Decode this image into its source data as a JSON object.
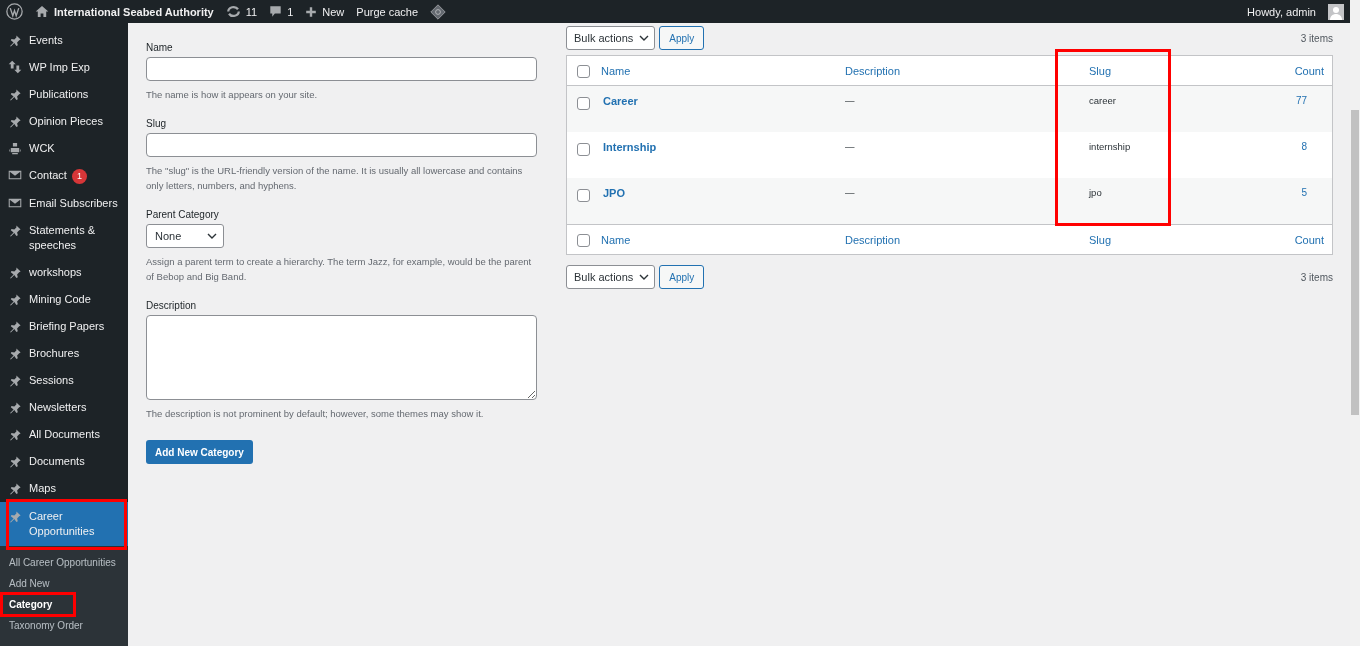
{
  "admin_bar": {
    "site": "International Seabed Authority",
    "updates": "11",
    "comments": "1",
    "new_label": "New",
    "purge": "Purge cache",
    "greeting": "Howdy, admin"
  },
  "sidebar": {
    "items": [
      {
        "label": "Events",
        "kind": "pin",
        "selected": false,
        "highlighted": false
      },
      {
        "label": "WP Imp Exp",
        "kind": "arrows",
        "selected": false,
        "highlighted": false
      },
      {
        "label": "Publications",
        "kind": "pin",
        "selected": false,
        "highlighted": false
      },
      {
        "label": "Opinion Pieces",
        "kind": "pin",
        "selected": false,
        "highlighted": false
      },
      {
        "label": "WCK",
        "kind": "robot",
        "selected": false,
        "highlighted": false
      },
      {
        "label": "Contact",
        "kind": "mail",
        "badge": "1",
        "selected": false,
        "highlighted": false
      },
      {
        "label": "Email Subscribers",
        "kind": "mail",
        "selected": false,
        "highlighted": false
      },
      {
        "label": "Statements & speeches",
        "kind": "pin",
        "selected": false,
        "highlighted": false
      },
      {
        "label": "workshops",
        "kind": "pin",
        "selected": false,
        "highlighted": false
      },
      {
        "label": "Mining Code",
        "kind": "pin",
        "selected": false,
        "highlighted": false
      },
      {
        "label": "Briefing Papers",
        "kind": "pin",
        "selected": false,
        "highlighted": false
      },
      {
        "label": "Brochures",
        "kind": "pin",
        "selected": false,
        "highlighted": false
      },
      {
        "label": "Sessions",
        "kind": "pin",
        "selected": false,
        "highlighted": false
      },
      {
        "label": "Newsletters",
        "kind": "pin",
        "selected": false,
        "highlighted": false
      },
      {
        "label": "All Documents",
        "kind": "pin",
        "selected": false,
        "highlighted": false
      },
      {
        "label": "Documents",
        "kind": "pin",
        "selected": false,
        "highlighted": false
      },
      {
        "label": "Maps",
        "kind": "pin",
        "selected": false,
        "highlighted": false
      },
      {
        "label": "Career Opportunities",
        "kind": "pin",
        "selected": true,
        "highlighted": true
      }
    ],
    "submenu": [
      {
        "label": "All Career Opportunities",
        "selected": false,
        "highlighted": false
      },
      {
        "label": "Add New",
        "selected": false,
        "highlighted": false
      },
      {
        "label": "Category",
        "selected": true,
        "highlighted": true
      },
      {
        "label": "Taxonomy Order",
        "selected": false,
        "highlighted": false
      }
    ]
  },
  "form": {
    "fields": [
      {
        "kind": "text",
        "label": "Name",
        "hint": "The name is how it appears on your site."
      },
      {
        "kind": "text",
        "label": "Slug",
        "hint": "The \"slug\" is the URL-friendly version of the name. It is usually all lowercase and contains only letters, numbers, and hyphens."
      },
      {
        "kind": "select",
        "label": "Parent Category",
        "value": "None",
        "hint": "Assign a parent term to create a hierarchy. The term Jazz, for example, would be the parent of Bebop and Big Band."
      },
      {
        "kind": "textarea",
        "label": "Description",
        "hint": "The description is not prominent by default; however, some themes may show it."
      }
    ],
    "submit": "Add New Category"
  },
  "table": {
    "top_bulk": {
      "select": "Bulk actions",
      "apply": "Apply",
      "count": "3 items"
    },
    "header_checked": false,
    "footer_checked": false,
    "columns": [
      {
        "label": "Name",
        "highlighted": false
      },
      {
        "label": "Description",
        "highlighted": false
      },
      {
        "label": "Slug",
        "highlighted": true
      },
      {
        "label": "Count",
        "highlighted": false
      }
    ],
    "rows": [
      {
        "name": "Career",
        "description": "—",
        "slug": "career",
        "count": "77",
        "checked": false
      },
      {
        "name": "Internship",
        "description": "—",
        "slug": "internship",
        "count": "8",
        "checked": false
      },
      {
        "name": "JPO",
        "description": "—",
        "slug": "jpo",
        "count": "5",
        "checked": false
      }
    ],
    "footer_columns": [
      "Name",
      "Description",
      "Slug",
      "Count"
    ],
    "bottom_bulk": {
      "select": "Bulk actions",
      "apply": "Apply",
      "count": "3 items"
    }
  }
}
